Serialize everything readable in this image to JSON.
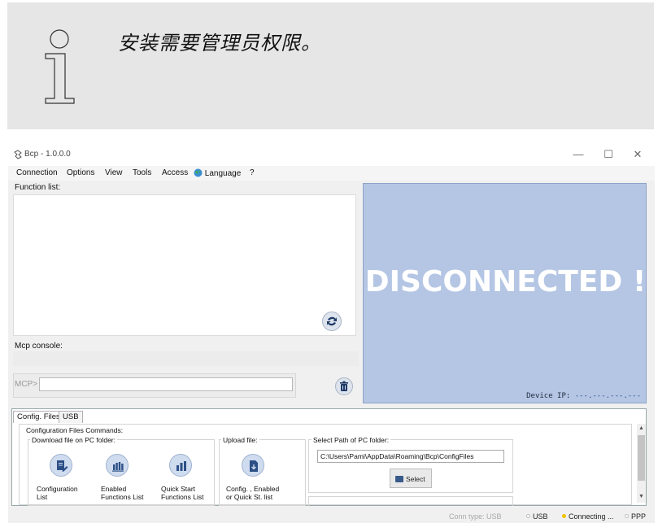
{
  "note": {
    "text": "安装需要管理员权限。",
    "icon": "info-icon"
  },
  "window": {
    "title": "Bcp - 1.0.0.0",
    "controls": {
      "minimize": "—",
      "maximize": "☐",
      "close": "✕"
    }
  },
  "menu": {
    "connection": "Connection",
    "options": "Options",
    "view": "View",
    "tools": "Tools",
    "access": "Access",
    "language": "Language",
    "help": "?"
  },
  "left": {
    "function_list_label": "Function list:",
    "mcp_console_label": "Mcp console:",
    "mcp_prompt": "MCP>",
    "mcp_input_value": ""
  },
  "status_panel": {
    "state": "DISCONNECTED !",
    "device_ip_label": "Device IP:",
    "device_ip_value": "---.---.---.---"
  },
  "tabs": {
    "config_files": "Config. Files",
    "usb": "USB"
  },
  "config": {
    "commands_title": "Configuration Files Commands:",
    "download_title": "Download file on PC folder:",
    "upload_title": "Upload file:",
    "select_path_title": "Select Path of PC folder:",
    "path_value": "C:\\Users\\Pami\\AppData\\Roaming\\Bcp\\ConfigFiles",
    "select_button": "Select",
    "buttons": [
      {
        "line1": "Configuration",
        "line2": "List"
      },
      {
        "line1": "Enabled",
        "line2": "Functions List"
      },
      {
        "line1": "Quick Start",
        "line2": "Functions List"
      },
      {
        "line1": "Config. , Enabled",
        "line2": "or Quick St. list"
      }
    ]
  },
  "statusbar": {
    "conn_type": "Conn type: USB",
    "usb": "USB",
    "connecting": "Connecting ...",
    "ppp": "PPP"
  },
  "colors": {
    "status_panel_bg": "#b4c6e4",
    "connecting_dot": "#f2c200",
    "idle_dot": "#bdbdbd"
  }
}
